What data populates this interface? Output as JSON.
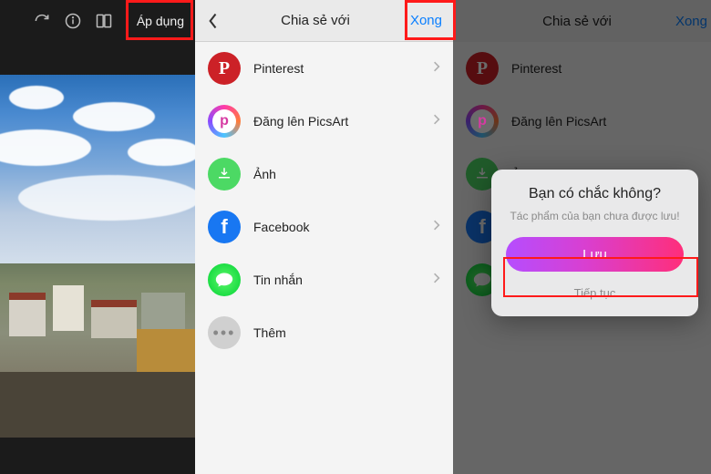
{
  "panel1": {
    "apply_label": "Áp dụng"
  },
  "panel2": {
    "header_title": "Chia sẻ với",
    "done_label": "Xong",
    "items": [
      {
        "label": "Pinterest"
      },
      {
        "label": "Đăng lên PicsArt"
      },
      {
        "label": "Ảnh"
      },
      {
        "label": "Facebook"
      },
      {
        "label": "Tin nhắn"
      },
      {
        "label": "Thêm"
      }
    ]
  },
  "panel3": {
    "header_title": "Chia sẻ với",
    "done_label": "Xong",
    "dialog": {
      "title": "Bạn có chắc không?",
      "subtitle": "Tác phẩm của bạn chưa được lưu!",
      "save_label": "Lưu",
      "continue_label": "Tiếp tục"
    }
  }
}
